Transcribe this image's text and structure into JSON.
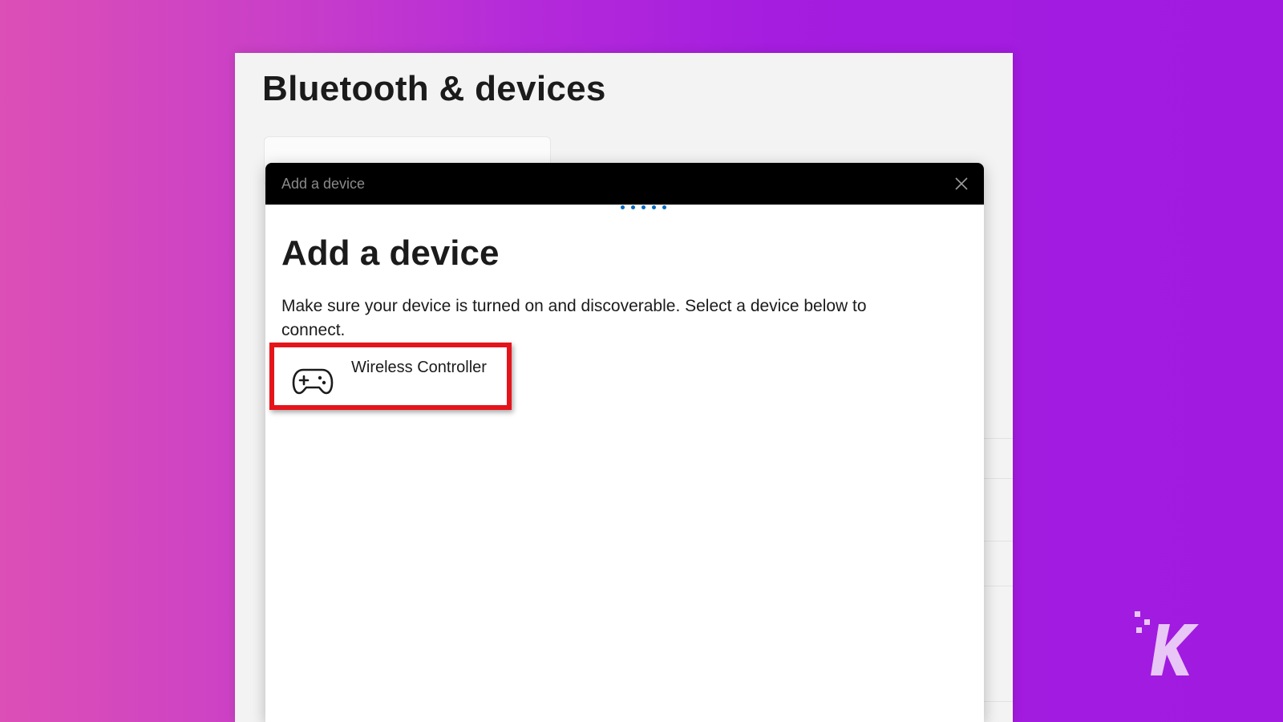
{
  "settings": {
    "title": "Bluetooth & devices"
  },
  "dialog": {
    "titlebar_text": "Add a device",
    "heading": "Add a device",
    "description": "Make sure your device is turned on and discoverable. Select a device below to connect.",
    "close_icon": "close-icon",
    "progress_indicator": "progress-dots"
  },
  "devices": [
    {
      "name": "Wireless Controller",
      "icon": "gamepad-icon"
    }
  ],
  "highlight": {
    "color": "#e5141b"
  },
  "colors": {
    "accent": "#0067c0",
    "titlebar": "#000000",
    "window_bg": "#f3f3f3",
    "dialog_bg": "#ffffff"
  }
}
